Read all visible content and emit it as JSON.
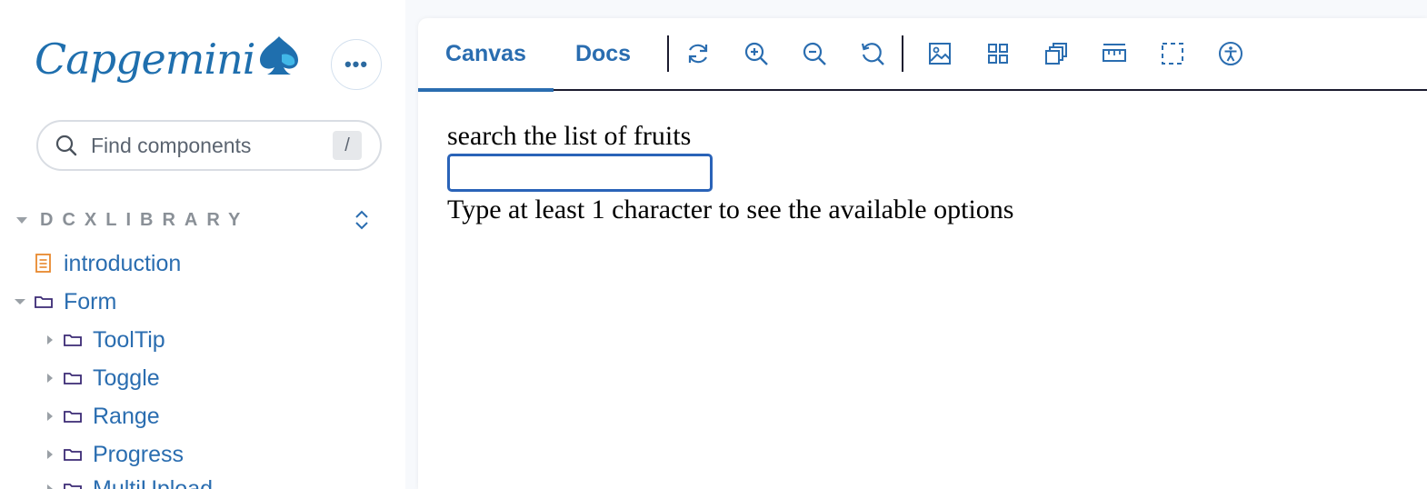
{
  "sidebar": {
    "logo_text": "Capgemini",
    "more_button": "•••",
    "search": {
      "placeholder": "Find components",
      "shortcut": "/"
    },
    "section_title": "DCXLIBRARY",
    "tree": [
      {
        "label": "introduction",
        "type": "doc",
        "depth": 0
      },
      {
        "label": "Form",
        "type": "folder",
        "depth": 0,
        "expanded": true
      },
      {
        "label": "ToolTip",
        "type": "folder",
        "depth": 1
      },
      {
        "label": "Toggle",
        "type": "folder",
        "depth": 1
      },
      {
        "label": "Range",
        "type": "folder",
        "depth": 1
      },
      {
        "label": "Progress",
        "type": "folder",
        "depth": 1
      },
      {
        "label": "MultiUpload",
        "type": "folder",
        "depth": 1
      }
    ]
  },
  "toolbar": {
    "tabs": [
      {
        "label": "Canvas",
        "active": true
      },
      {
        "label": "Docs",
        "active": false
      }
    ],
    "tools": [
      "reload-icon",
      "zoom-in-icon",
      "zoom-out-icon",
      "reset-zoom-icon",
      "background-icon",
      "grid-icon",
      "viewport-icon",
      "measure-icon",
      "outline-icon",
      "accessibility-icon"
    ]
  },
  "canvas": {
    "label": "search the list of fruits",
    "input_value": "",
    "hint": "Type at least 1 character to see the available options"
  },
  "colors": {
    "accent": "#2a6db0",
    "folder_icon": "#3b2a74",
    "doc_icon": "#e8892d",
    "input_border": "#2a63b8"
  }
}
